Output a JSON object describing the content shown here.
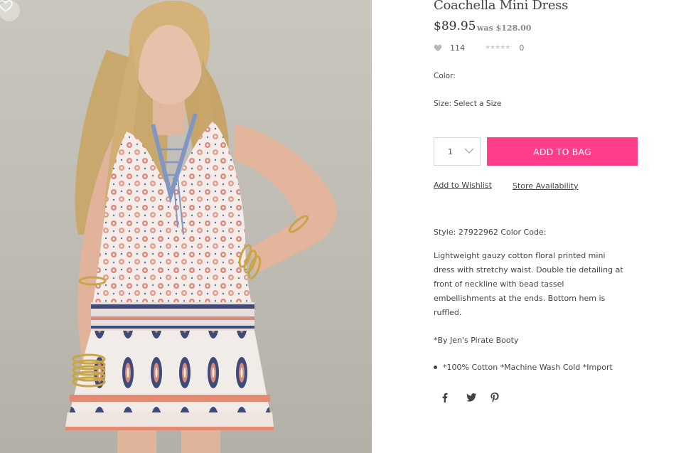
{
  "product": {
    "title": "Coachella Mini Dress",
    "price": "$89.95",
    "was_price": "was $128.00",
    "likes": "114",
    "rating_stars": 0,
    "review_count": "0",
    "color_label": "Color:",
    "size_label": "Size: Select a Size",
    "quantity": "1",
    "add_to_bag": "ADD TO BAG",
    "add_to_wishlist": "Add to Wishlist",
    "store_availability": "Store Availability",
    "style_line": "Style: 27922962 Color Code:",
    "description": "Lightweight gauzy cotton floral printed mini dress with stretchy waist. Double tie detailing at front of neckline with bead tassel embellishments at the ends. Bottom hem is ruffled.",
    "brand_note": "*By Jen's Pirate Booty",
    "care_bullet": "*100% Cotton *Machine Wash Cold *Import"
  },
  "icons": {
    "favorite": "heart-outline-icon",
    "likes": "heart-icon",
    "rating": "star-icon",
    "quantity_dropdown": "chevron-down-icon",
    "social": [
      "facebook-icon",
      "twitter-icon",
      "pinterest-icon"
    ]
  },
  "colors": {
    "accent": "#ff3d8b",
    "text": "#444444",
    "muted": "#888888"
  }
}
